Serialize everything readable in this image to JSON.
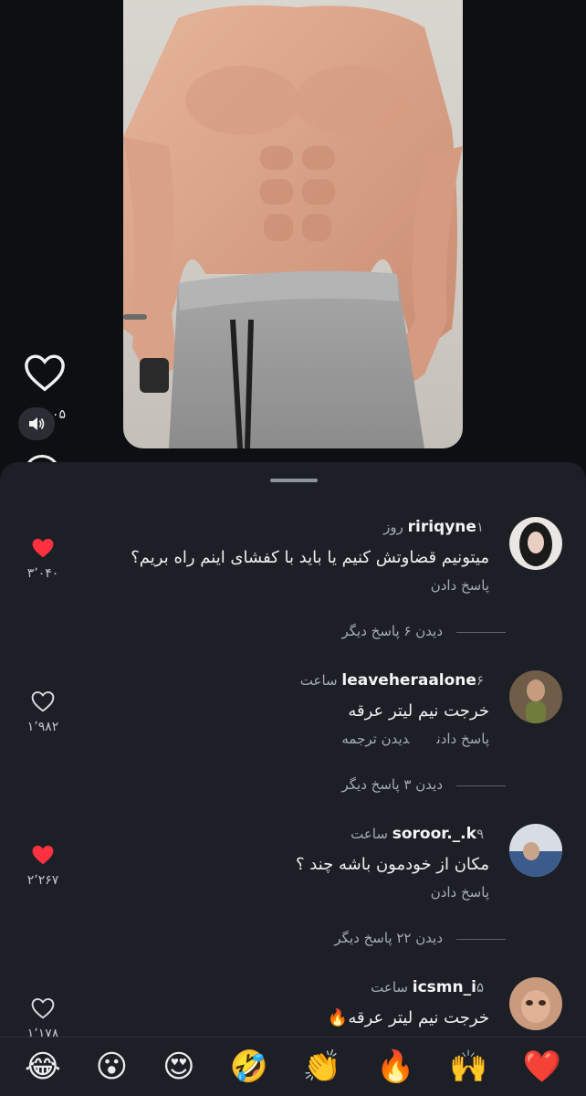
{
  "reel": {
    "like_count": "۰۵"
  },
  "comments": [
    {
      "username": "ririqyne",
      "time": "۱ روز",
      "text": "میتونیم قضاوتش کنیم یا باید با کفشای اینم راه بریم؟",
      "actions": [
        "پاسخ دادن"
      ],
      "likes": "۳٬۰۴۰",
      "liked": true,
      "more_replies": "دیدن ۶ پاسخ دیگر"
    },
    {
      "username": "leaveheraalone",
      "time": "۶ ساعت",
      "text": "خرجت نیم لیتر عرقه",
      "actions": [
        "پاسخ دادن",
        "دیدن ترجمه"
      ],
      "likes": "۱٬۹۸۲",
      "liked": false,
      "more_replies": "دیدن ۳ پاسخ دیگر"
    },
    {
      "username": "soroor._.k",
      "time": "۹ ساعت",
      "text": "مکان از خودمون باشه چند ؟",
      "actions": [
        "پاسخ دادن"
      ],
      "likes": "۲٬۲۶۷",
      "liked": true,
      "more_replies": "دیدن ۲۲ پاسخ دیگر"
    },
    {
      "username": "icsmn_i",
      "time": "۵ ساعت",
      "text": "خرجت نیم لیتر عرقه🔥",
      "actions": [],
      "likes": "۱٬۱۷۸",
      "liked": false,
      "more_replies": ""
    }
  ],
  "emoji_bar": [
    "😂",
    "😮",
    "😍",
    "🤣",
    "👏",
    "🔥",
    "🙌",
    "❤️"
  ],
  "colors": {
    "background": "#0d0f12",
    "sheet": "#1c1f25",
    "liked_heart": "#ff3040",
    "muted_text": "#a8adb5"
  }
}
